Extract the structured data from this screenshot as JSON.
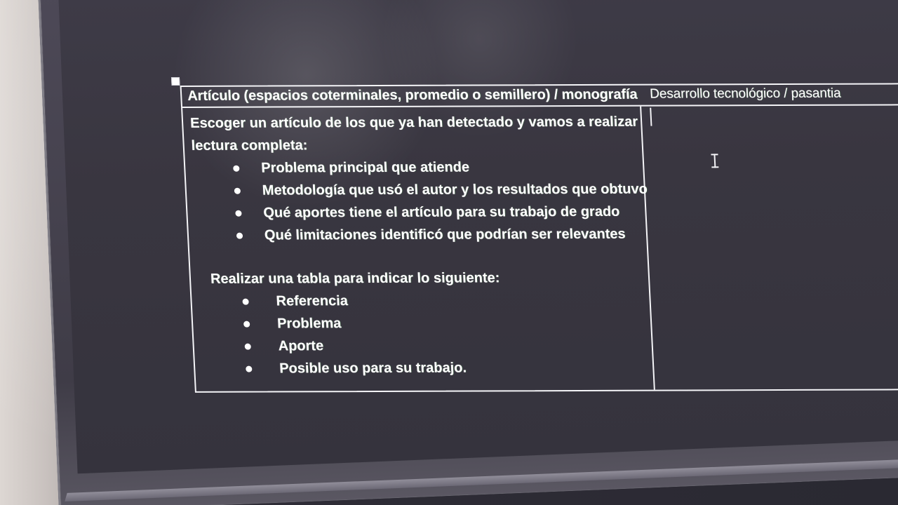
{
  "table": {
    "headers": {
      "left": "Artículo (espacios coterminales, promedio o semillero) / monografía",
      "right": "Desarrollo tecnológico / pasantia"
    },
    "content": {
      "intro_line_1": "Escoger un artículo de los que ya han detectado y vamos a realizar",
      "intro_line_2": "lectura completa:",
      "first_list": [
        "Problema principal que atiende",
        "Metodología que usó el autor y los resultados que obtuvo",
        "Qué aportes tiene el artículo para su trabajo de grado",
        "Qué limitaciones identificó que podrían ser relevantes"
      ],
      "section_title": "Realizar una tabla para indicar lo siguiente:",
      "second_list": [
        "Referencia",
        "Problema",
        "Aporte",
        "Posible uso para su trabajo."
      ]
    }
  }
}
